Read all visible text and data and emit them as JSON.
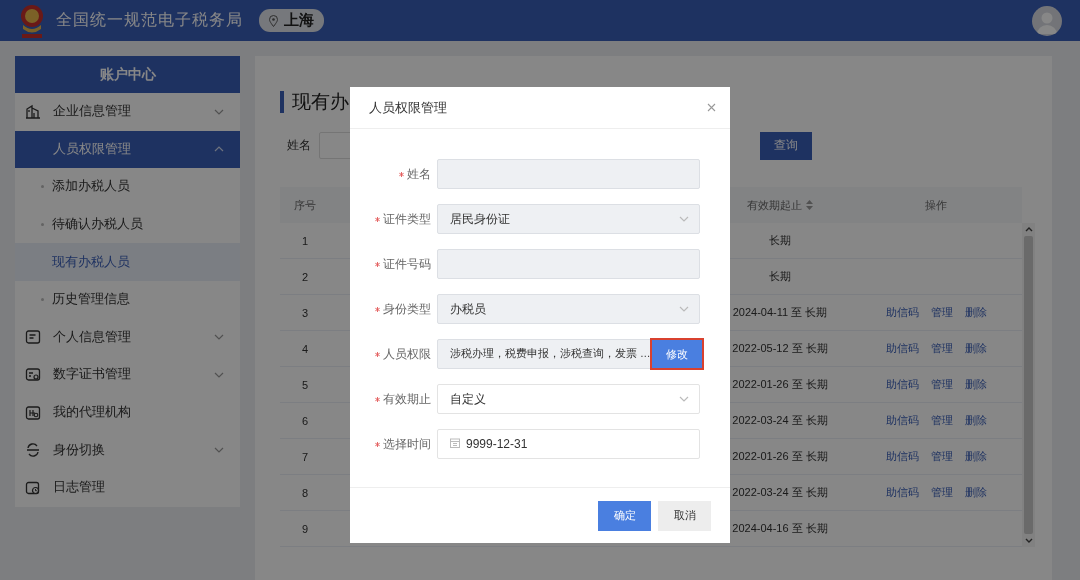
{
  "header": {
    "title": "全国统一规范电子税务局",
    "location": "上海"
  },
  "sidebar": {
    "title": "账户中心",
    "items": [
      {
        "label": "企业信息管理",
        "expandable": true,
        "expanded": false,
        "selected": false
      },
      {
        "label": "人员权限管理",
        "expandable": true,
        "expanded": true,
        "selected": true,
        "children": [
          {
            "label": "添加办税人员",
            "selected": false
          },
          {
            "label": "待确认办税人员",
            "selected": false
          },
          {
            "label": "现有办税人员",
            "selected": true
          },
          {
            "label": "历史管理信息",
            "selected": false
          }
        ]
      },
      {
        "label": "个人信息管理",
        "expandable": true,
        "expanded": false,
        "selected": false
      },
      {
        "label": "数字证书管理",
        "expandable": true,
        "expanded": false,
        "selected": false
      },
      {
        "label": "我的代理机构",
        "expandable": false,
        "expanded": false,
        "selected": false
      },
      {
        "label": "身份切换",
        "expandable": true,
        "expanded": false,
        "selected": false
      },
      {
        "label": "日志管理",
        "expandable": false,
        "expanded": false,
        "selected": false
      }
    ]
  },
  "main": {
    "title": "现有办",
    "search": {
      "label": "姓名",
      "button": "查询"
    },
    "table": {
      "columns": [
        {
          "label": "序号",
          "sortable": false
        },
        {
          "label": "有效期起止",
          "sortable": true
        },
        {
          "label": "操作",
          "sortable": false
        }
      ],
      "rows": [
        {
          "index": "1",
          "validity": "长期",
          "actions": []
        },
        {
          "index": "2",
          "validity": "长期",
          "actions": []
        },
        {
          "index": "3",
          "validity": "2024-04-11 至 长期",
          "actions": [
            "助信码",
            "管理",
            "删除"
          ]
        },
        {
          "index": "4",
          "validity": "2022-05-12 至 长期",
          "actions": [
            "助信码",
            "管理",
            "删除"
          ]
        },
        {
          "index": "5",
          "validity": "2022-01-26 至 长期",
          "actions": [
            "助信码",
            "管理",
            "删除"
          ]
        },
        {
          "index": "6",
          "validity": "2022-03-24 至 长期",
          "actions": [
            "助信码",
            "管理",
            "删除"
          ]
        },
        {
          "index": "7",
          "validity": "2022-01-26 至 长期",
          "actions": [
            "助信码",
            "管理",
            "删除"
          ]
        },
        {
          "index": "8",
          "validity": "2022-03-24 至 长期",
          "actions": [
            "助信码",
            "管理",
            "删除"
          ]
        },
        {
          "index": "9",
          "validity": "2024-04-16 至 长期",
          "actions": []
        }
      ]
    }
  },
  "modal": {
    "title": "人员权限管理",
    "fields": [
      {
        "label": "姓名",
        "kind": "text",
        "required": true,
        "disabled": true
      },
      {
        "label": "证件类型",
        "kind": "select",
        "value": "居民身份证",
        "required": true,
        "disabled": true
      },
      {
        "label": "证件号码",
        "kind": "text",
        "required": true,
        "disabled": true
      },
      {
        "label": "身份类型",
        "kind": "select",
        "value": "办税员",
        "required": true,
        "disabled": true
      },
      {
        "label": "人员权限",
        "kind": "permission",
        "value": "涉税办理，税费申报，涉税查询，发票 …",
        "button": "修改",
        "highlighted": true,
        "required": true,
        "disabled": true
      },
      {
        "label": "有效期止",
        "kind": "select",
        "value": "自定义",
        "required": true,
        "disabled": false
      },
      {
        "label": "选择时间",
        "kind": "date",
        "value": "9999-12-31",
        "required": true,
        "disabled": false
      }
    ],
    "buttons": [
      {
        "label": "确定",
        "primary": true
      },
      {
        "label": "取消",
        "primary": false
      }
    ]
  }
}
